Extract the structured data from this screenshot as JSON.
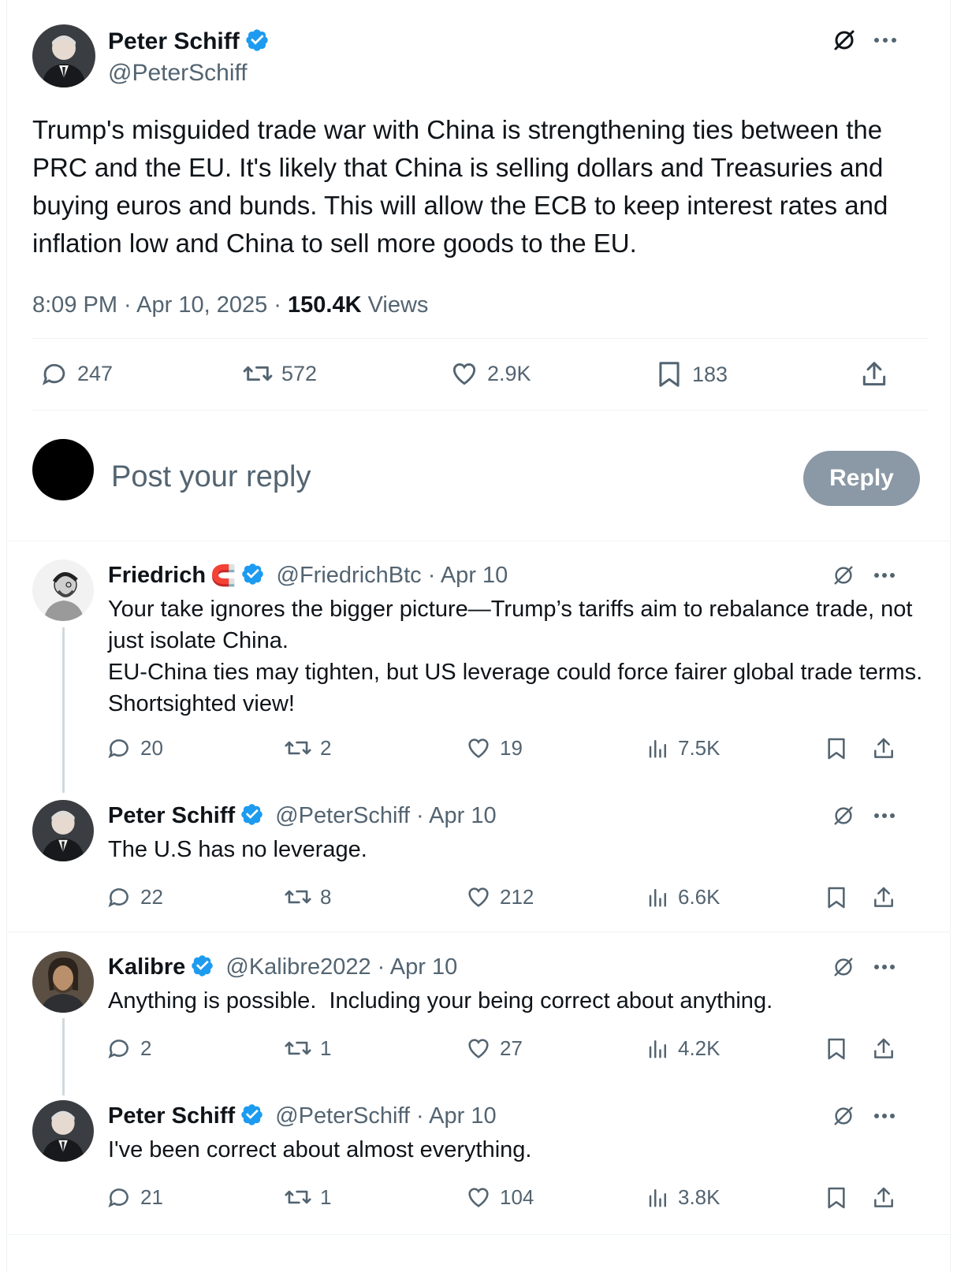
{
  "main_post": {
    "author_name": "Peter Schiff",
    "handle": "@PeterSchiff",
    "text": "Trump's misguided trade war with China is strengthening ties between the PRC and the EU. It's likely that China is selling dollars and Treasuries and buying euros and bunds. This will allow the ECB to keep interest rates and inflation low and China to sell more goods to the EU.",
    "time": "8:09 PM · Apr 10, 2025 · ",
    "views_count": "150.4K",
    "views_label": " Views",
    "replies": "247",
    "reposts": "572",
    "likes": "2.9K",
    "bookmarks": "183"
  },
  "reply_box": {
    "placeholder": "Post your reply",
    "button_label": "Reply"
  },
  "replies": [
    {
      "author_name": "Friedrich",
      "handle": "@FriedrichBtc",
      "date": " · Apr 10",
      "text_line1": "Your take ignores the bigger picture—Trump’s tariffs aim to rebalance trade, not just isolate China.",
      "text_line2": "EU-China ties may tighten, but US leverage could force fairer global trade terms. Shortsighted view!",
      "replies": "20",
      "reposts": "2",
      "likes": "19",
      "views": "7.5K"
    },
    {
      "author_name": "Peter Schiff",
      "handle": "@PeterSchiff",
      "date": " · Apr 10",
      "text": "The U.S has no leverage.",
      "replies": "22",
      "reposts": "8",
      "likes": "212",
      "views": "6.6K"
    },
    {
      "author_name": "Kalibre",
      "handle": "@Kalibre2022",
      "date": " · Apr 10",
      "text": "Anything is possible.  Including your being correct about anything.",
      "replies": "2",
      "reposts": "1",
      "likes": "27",
      "views": "4.2K"
    },
    {
      "author_name": "Peter Schiff",
      "handle": "@PeterSchiff",
      "date": " · Apr 10",
      "text": "I've been correct about almost everything.",
      "replies": "21",
      "reposts": "1",
      "likes": "104",
      "views": "3.8K"
    }
  ],
  "colors": {
    "verified_blue": "#1d9bf0",
    "secondary_text": "#536471",
    "reply_button_disabled": "#8b98a5",
    "thread_line": "#cfd9de"
  },
  "icons": [
    "grok-icon",
    "more-icon",
    "reply-icon",
    "repost-icon",
    "like-icon",
    "bookmark-icon",
    "share-icon",
    "views-icon",
    "verified-badge-icon",
    "magnet-emoji"
  ]
}
